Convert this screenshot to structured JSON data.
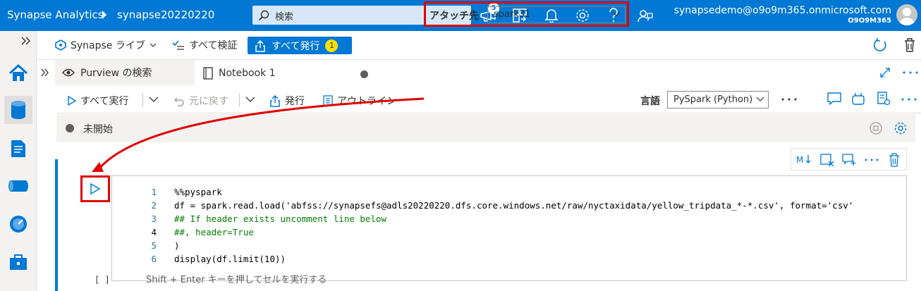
{
  "topbar": {
    "app_name": "Synapse Analytics",
    "workspace": "synapse20220220",
    "search_placeholder": "検索",
    "notifications_count": "5",
    "account_email": "synapsedemo@o9o9m365.onmicrosoft.com",
    "account_tenant": "O9O9M365"
  },
  "toolbar": {
    "live_mode": "Synapse ライブ",
    "validate_all": "すべて検証",
    "publish_all": "すべて発行",
    "publish_count": "1"
  },
  "tabs": [
    {
      "label": "Purview の検索"
    },
    {
      "label": "Notebook 1"
    }
  ],
  "notebook_toolbar": {
    "run_all": "すべて実行",
    "undo": "元に戻す",
    "publish": "発行",
    "outline": "アウトライン",
    "attach_label": "アタッチ先",
    "attach_value": "spark31",
    "language_label": "言語",
    "language_value": "PySpark (Python)"
  },
  "status": {
    "session_state": "未開始"
  },
  "cell": {
    "execution_count": "[ ]",
    "hint": "Shift + Enter キーを押してセルを実行する",
    "lines": [
      {
        "n": "1",
        "text": "%%pyspark"
      },
      {
        "n": "2",
        "text": "df = spark.read.load('abfss://synapsefs@adls20220220.dfs.core.windows.net/raw/nyctaxidata/yellow_tripdata_*-*.csv', format='csv'"
      },
      {
        "n": "3",
        "text": "## If header exists uncomment line below"
      },
      {
        "n": "4",
        "text": "##, header=True"
      },
      {
        "n": "5",
        "text": ")"
      },
      {
        "n": "6",
        "text": "display(df.limit(10))"
      }
    ]
  },
  "colors": {
    "accent": "#0078d4",
    "highlight": "#e00000"
  }
}
